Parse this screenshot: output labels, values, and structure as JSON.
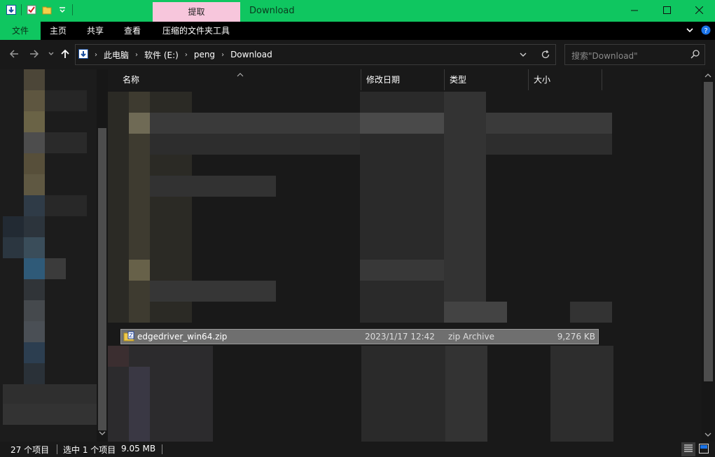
{
  "titlebar": {
    "contextual_tab": "提取",
    "window_title": "Download",
    "accent_color": "#0fc660",
    "contextual_color": "#f7c6dc"
  },
  "ribbon": {
    "tabs": [
      {
        "label": "文件"
      },
      {
        "label": "主页"
      },
      {
        "label": "共享"
      },
      {
        "label": "查看"
      },
      {
        "label": "压缩的文件夹工具"
      }
    ]
  },
  "address": {
    "crumbs": [
      "此电脑",
      "软件 (E:)",
      "peng",
      "Download"
    ]
  },
  "search": {
    "placeholder": "搜索\"Download\""
  },
  "columns": {
    "name": "名称",
    "date": "修改日期",
    "type": "类型",
    "size": "大小"
  },
  "selected_file": {
    "name": "edgedriver_win64.zip",
    "date": "2023/1/17 12:42",
    "type": "zip Archive",
    "size": "9,276 KB"
  },
  "status": {
    "count": "27 个项目",
    "selected": "选中 1 个项目",
    "size": "9.05 MB"
  },
  "icons": {
    "qat": [
      "properties-icon",
      "checklist-icon",
      "new-folder-icon",
      "customize-qat-icon"
    ],
    "window": [
      "minimize-icon",
      "maximize-icon",
      "close-icon"
    ],
    "nav": [
      "back-icon",
      "forward-icon",
      "recent-locations-icon",
      "up-icon"
    ]
  }
}
